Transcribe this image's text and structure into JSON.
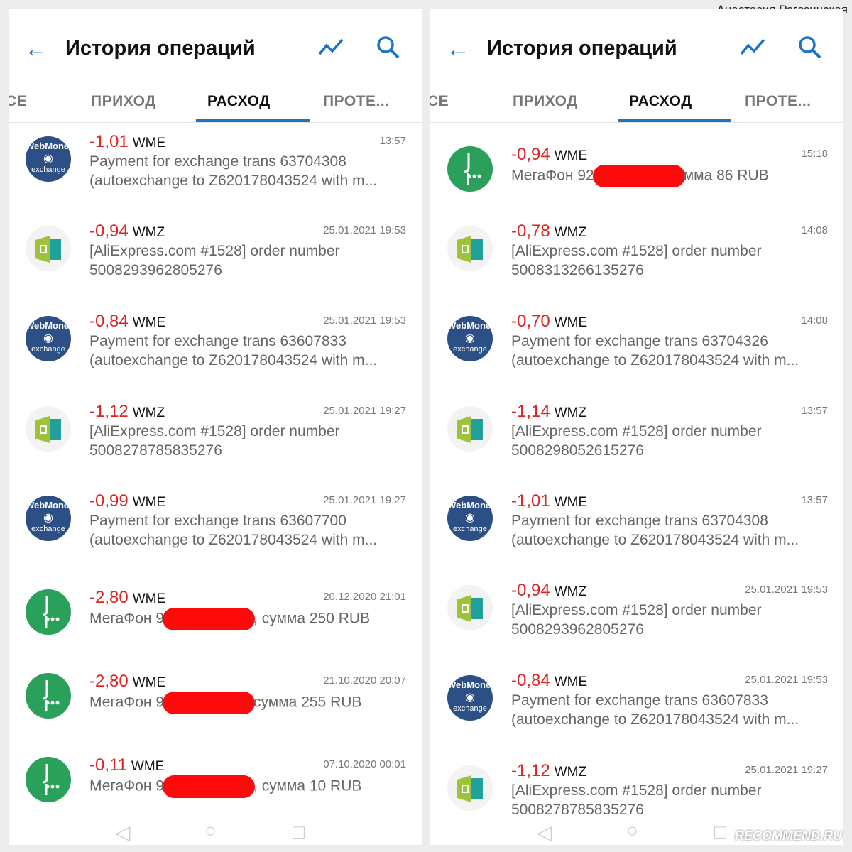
{
  "author": "Анастасия Рогозинская",
  "watermark": "RECOMMEND.RU",
  "colors": {
    "accent": "#1f73c4",
    "negative": "#e02424"
  },
  "panels": [
    {
      "title": "История операций",
      "tabs": [
        "СЕ",
        "ПРИХОД",
        "РАСХОД",
        "ПРОТЕ..."
      ],
      "active_tab": "РАСХОД",
      "items": [
        {
          "type": "webmoney-exchange",
          "amount": "-1,01",
          "currency": "WME",
          "time": "13:57",
          "lines": [
            "Payment for exchange trans 63704308",
            "(autoexchange to Z620178043524 with m..."
          ]
        },
        {
          "type": "aliexpress",
          "amount": "-0,94",
          "currency": "WMZ",
          "time": "25.01.2021 19:53",
          "lines": [
            "[AliExpress.com #1528] order number",
            "5008293962805276"
          ]
        },
        {
          "type": "webmoney-exchange",
          "amount": "-0,84",
          "currency": "WME",
          "time": "25.01.2021 19:53",
          "lines": [
            "Payment for exchange trans 63607833",
            "(autoexchange to Z620178043524 with m..."
          ]
        },
        {
          "type": "aliexpress",
          "amount": "-1,12",
          "currency": "WMZ",
          "time": "25.01.2021 19:27",
          "lines": [
            "[AliExpress.com #1528] order number",
            "5008278785835276"
          ]
        },
        {
          "type": "webmoney-exchange",
          "amount": "-0,99",
          "currency": "WME",
          "time": "25.01.2021 19:27",
          "lines": [
            "Payment for exchange trans 63607700",
            "(autoexchange to Z620178043524 with m..."
          ]
        },
        {
          "type": "megafon",
          "amount": "-2,80",
          "currency": "WME",
          "time": "20.12.2020 21:01",
          "before": "МегаФон 9",
          "after": ", сумма 250 RUB"
        },
        {
          "type": "megafon",
          "amount": "-2,80",
          "currency": "WME",
          "time": "21.10.2020 20:07",
          "before": "МегаФон 9",
          "after": "сумма 255 RUB"
        },
        {
          "type": "megafon",
          "amount": "-0,11",
          "currency": "WME",
          "time": "07.10.2020 00:01",
          "before": "МегаФон 9",
          "after": ", сумма 10 RUB"
        }
      ]
    },
    {
      "title": "История операций",
      "tabs": [
        "СЕ",
        "ПРИХОД",
        "РАСХОД",
        "ПРОТЕ..."
      ],
      "active_tab": "РАСХОД",
      "items": [
        {
          "type": "megafon",
          "amount": "-0,94",
          "currency": "WME",
          "time": "15:18",
          "before": "МегаФон 92",
          "after": "мма 86 RUB"
        },
        {
          "type": "aliexpress",
          "amount": "-0,78",
          "currency": "WMZ",
          "time": "14:08",
          "lines": [
            "[AliExpress.com #1528] order number",
            "5008313266135276"
          ]
        },
        {
          "type": "webmoney-exchange",
          "amount": "-0,70",
          "currency": "WME",
          "time": "14:08",
          "lines": [
            "Payment for exchange trans 63704326",
            "(autoexchange to Z620178043524 with m..."
          ]
        },
        {
          "type": "aliexpress",
          "amount": "-1,14",
          "currency": "WMZ",
          "time": "13:57",
          "lines": [
            "[AliExpress.com #1528] order number",
            "5008298052615276"
          ]
        },
        {
          "type": "webmoney-exchange",
          "amount": "-1,01",
          "currency": "WME",
          "time": "13:57",
          "lines": [
            "Payment for exchange trans 63704308",
            "(autoexchange to Z620178043524 with m..."
          ]
        },
        {
          "type": "aliexpress",
          "amount": "-0,94",
          "currency": "WMZ",
          "time": "25.01.2021 19:53",
          "lines": [
            "[AliExpress.com #1528] order number",
            "5008293962805276"
          ]
        },
        {
          "type": "webmoney-exchange",
          "amount": "-0,84",
          "currency": "WME",
          "time": "25.01.2021 19:53",
          "lines": [
            "Payment for exchange trans 63607833",
            "(autoexchange to Z620178043524 with m..."
          ]
        },
        {
          "type": "aliexpress",
          "amount": "-1,12",
          "currency": "WMZ",
          "time": "25.01.2021 19:27",
          "lines": [
            "[AliExpress.com #1528] order number",
            "5008278785835276"
          ]
        }
      ]
    }
  ]
}
